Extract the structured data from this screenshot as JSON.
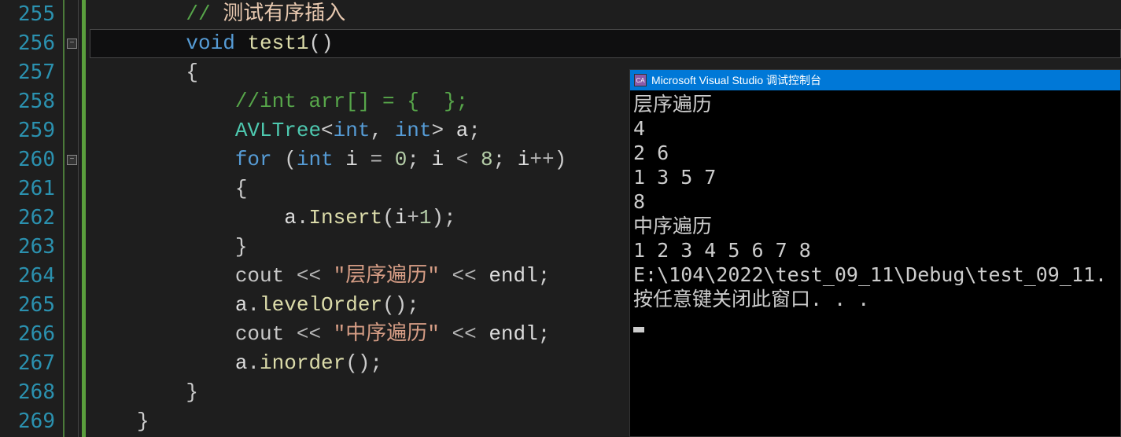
{
  "editor": {
    "lines": [
      {
        "num": "255",
        "indent": "    ",
        "tokens": [
          {
            "t": "comment",
            "v": "// "
          },
          {
            "t": "comment-cjk",
            "v": "测试有序插入"
          }
        ]
      },
      {
        "num": "256",
        "indent": "    ",
        "hl": true,
        "fold": true,
        "tokens": [
          {
            "t": "keyword",
            "v": "void"
          },
          {
            "t": "ident",
            "v": " "
          },
          {
            "t": "func",
            "v": "test1"
          },
          {
            "t": "punct",
            "v": "()"
          }
        ]
      },
      {
        "num": "257",
        "indent": "    ",
        "tokens": [
          {
            "t": "punct",
            "v": "{"
          }
        ]
      },
      {
        "num": "258",
        "indent": "        ",
        "tokens": [
          {
            "t": "comment",
            "v": "//int arr[] = {  };"
          }
        ]
      },
      {
        "num": "259",
        "indent": "        ",
        "tokens": [
          {
            "t": "type",
            "v": "AVLTree"
          },
          {
            "t": "punct",
            "v": "<"
          },
          {
            "t": "keyword",
            "v": "int"
          },
          {
            "t": "punct",
            "v": ", "
          },
          {
            "t": "keyword",
            "v": "int"
          },
          {
            "t": "punct",
            "v": "> "
          },
          {
            "t": "ident",
            "v": "a"
          },
          {
            "t": "punct",
            "v": ";"
          }
        ]
      },
      {
        "num": "260",
        "indent": "        ",
        "fold": true,
        "tokens": [
          {
            "t": "keyword",
            "v": "for"
          },
          {
            "t": "punct",
            "v": " ("
          },
          {
            "t": "keyword",
            "v": "int"
          },
          {
            "t": "ident",
            "v": " i "
          },
          {
            "t": "op",
            "v": "="
          },
          {
            "t": "ident",
            "v": " "
          },
          {
            "t": "num",
            "v": "0"
          },
          {
            "t": "punct",
            "v": "; "
          },
          {
            "t": "ident",
            "v": "i "
          },
          {
            "t": "op",
            "v": "<"
          },
          {
            "t": "ident",
            "v": " "
          },
          {
            "t": "num",
            "v": "8"
          },
          {
            "t": "punct",
            "v": "; "
          },
          {
            "t": "ident",
            "v": "i"
          },
          {
            "t": "op",
            "v": "++"
          },
          {
            "t": "punct",
            "v": ")"
          }
        ]
      },
      {
        "num": "261",
        "indent": "        ",
        "tokens": [
          {
            "t": "punct",
            "v": "{"
          }
        ]
      },
      {
        "num": "262",
        "indent": "            ",
        "tokens": [
          {
            "t": "ident",
            "v": "a"
          },
          {
            "t": "punct",
            "v": "."
          },
          {
            "t": "func",
            "v": "Insert"
          },
          {
            "t": "punct",
            "v": "("
          },
          {
            "t": "ident",
            "v": "i"
          },
          {
            "t": "op",
            "v": "+"
          },
          {
            "t": "num",
            "v": "1"
          },
          {
            "t": "punct",
            "v": ");"
          }
        ]
      },
      {
        "num": "263",
        "indent": "        ",
        "tokens": [
          {
            "t": "punct",
            "v": "}"
          }
        ]
      },
      {
        "num": "264",
        "indent": "        ",
        "tokens": [
          {
            "t": "cout",
            "v": "cout "
          },
          {
            "t": "op",
            "v": "<<"
          },
          {
            "t": "ident",
            "v": " "
          },
          {
            "t": "string",
            "v": "\"层序遍历\""
          },
          {
            "t": "ident",
            "v": " "
          },
          {
            "t": "op",
            "v": "<<"
          },
          {
            "t": "ident",
            "v": " endl"
          },
          {
            "t": "punct",
            "v": ";"
          }
        ]
      },
      {
        "num": "265",
        "indent": "        ",
        "tokens": [
          {
            "t": "ident",
            "v": "a"
          },
          {
            "t": "punct",
            "v": "."
          },
          {
            "t": "func",
            "v": "levelOrder"
          },
          {
            "t": "punct",
            "v": "();"
          }
        ]
      },
      {
        "num": "266",
        "indent": "        ",
        "tokens": [
          {
            "t": "cout",
            "v": "cout "
          },
          {
            "t": "op",
            "v": "<<"
          },
          {
            "t": "ident",
            "v": " "
          },
          {
            "t": "string",
            "v": "\"中序遍历\""
          },
          {
            "t": "ident",
            "v": " "
          },
          {
            "t": "op",
            "v": "<<"
          },
          {
            "t": "ident",
            "v": " endl"
          },
          {
            "t": "punct",
            "v": ";"
          }
        ]
      },
      {
        "num": "267",
        "indent": "        ",
        "tokens": [
          {
            "t": "ident",
            "v": "a"
          },
          {
            "t": "punct",
            "v": "."
          },
          {
            "t": "func",
            "v": "inorder"
          },
          {
            "t": "punct",
            "v": "();"
          }
        ]
      },
      {
        "num": "268",
        "indent": "    ",
        "tokens": [
          {
            "t": "punct",
            "v": "}"
          }
        ]
      },
      {
        "num": "269",
        "indent": "",
        "tokens": [
          {
            "t": "punct",
            "v": "}"
          }
        ]
      }
    ]
  },
  "console": {
    "title": "Microsoft Visual Studio 调试控制台",
    "icon_label": "CA",
    "output": [
      "层序遍历",
      "4",
      "2 6",
      "1 3 5 7",
      "8",
      "中序遍历",
      "1 2 3 4 5 6 7 8",
      "E:\\104\\2022\\test_09_11\\Debug\\test_09_11.",
      "按任意键关闭此窗口. . ."
    ]
  }
}
